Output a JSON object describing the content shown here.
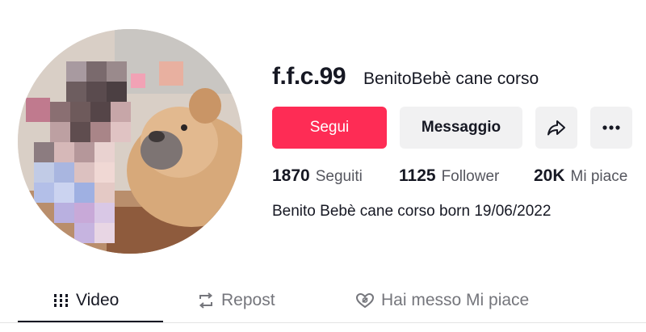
{
  "profile": {
    "username": "f.f.c.99",
    "nickname": "BenitoBebè cane corso",
    "bio": "Benito Bebè cane corso born 19/06/2022"
  },
  "actions": {
    "follow_label": "Segui",
    "message_label": "Messaggio",
    "share_icon": "share-arrow-icon",
    "more_icon": "more-dots-icon"
  },
  "stats": {
    "following_count": "1870",
    "following_label": "Seguiti",
    "followers_count": "1125",
    "followers_label": "Follower",
    "likes_count": "20K",
    "likes_label": "Mi piace"
  },
  "tabs": [
    {
      "label": "Video",
      "icon": "grid-icon",
      "active": true
    },
    {
      "label": "Repost",
      "icon": "repost-icon",
      "active": false
    },
    {
      "label": "Hai messo Mi piace",
      "icon": "heart-hidden-icon",
      "active": false
    }
  ],
  "colors": {
    "accent": "#fe2c55",
    "text": "#161823",
    "secondary_text": "#75767c",
    "button_bg": "#f1f1f2"
  }
}
